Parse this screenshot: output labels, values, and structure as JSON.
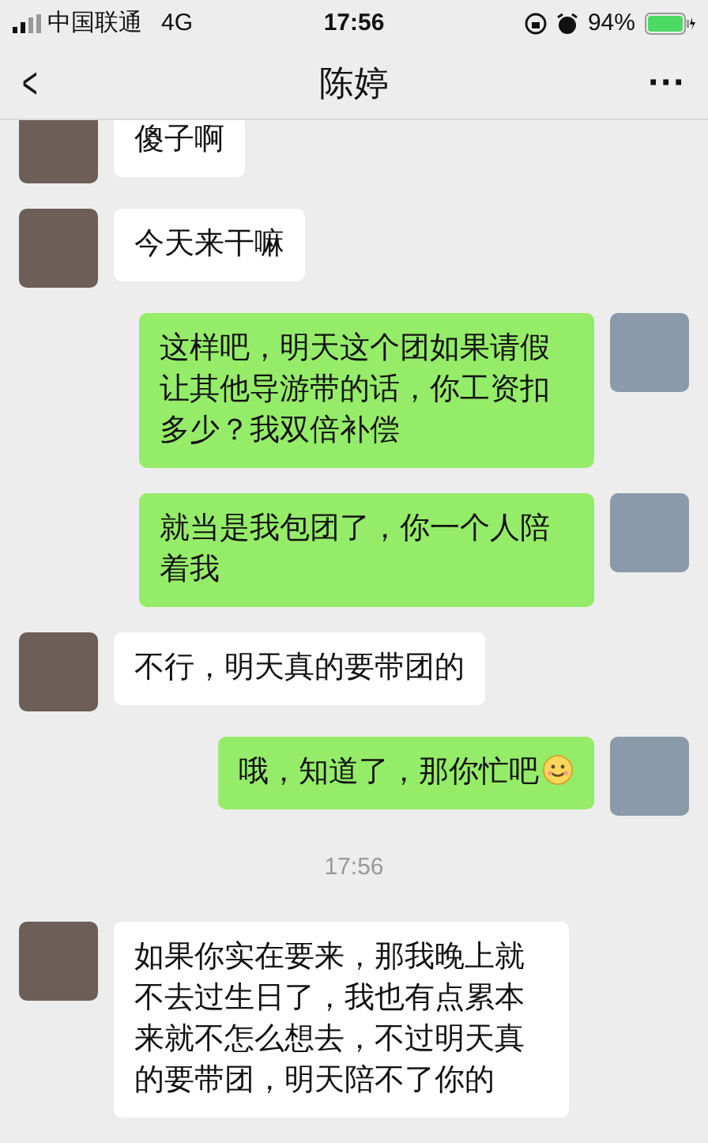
{
  "status_bar": {
    "carrier": "中国联通",
    "network": "4G",
    "time": "17:56",
    "battery": "94%"
  },
  "nav": {
    "back": "<",
    "title": "陈婷",
    "more": "···"
  },
  "messages": [
    {
      "kind": "incoming",
      "text": "傻子啊",
      "smiley": false
    },
    {
      "kind": "incoming",
      "text": "今天来干嘛",
      "smiley": false
    },
    {
      "kind": "outgoing",
      "text": "这样吧，明天这个团如果请假让其他导游带的话，你工资扣多少？我双倍补偿",
      "smiley": false
    },
    {
      "kind": "outgoing",
      "text": "就当是我包团了，你一个人陪着我",
      "smiley": false
    },
    {
      "kind": "incoming",
      "text": "不行，明天真的要带团的",
      "smiley": false
    },
    {
      "kind": "outgoing",
      "text": "哦，知道了，那你忙吧",
      "smiley": true
    },
    {
      "kind": "time",
      "text": "17:56"
    },
    {
      "kind": "incoming",
      "text": "如果你实在要来，那我晚上就不去过生日了，我也有点累本来就不怎么想去，不过明天真的要带团，明天陪不了你的",
      "smiley": false
    }
  ]
}
